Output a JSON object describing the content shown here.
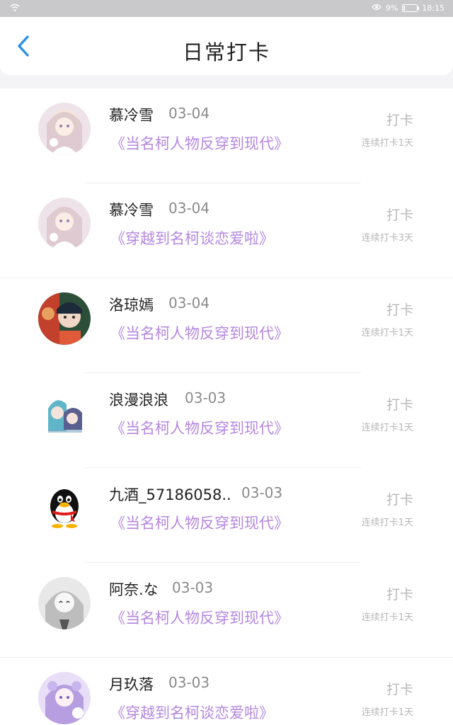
{
  "status": {
    "battery": "9%",
    "time": "18:15",
    "battery_level": 0.09
  },
  "header": {
    "title": "日常打卡"
  },
  "entries": [
    {
      "name": "慕冷雪",
      "date": "03-04",
      "book": "《当名柯人物反穿到现代》",
      "action": "打卡",
      "streak": "连续打卡1天"
    },
    {
      "name": "慕冷雪",
      "date": "03-04",
      "book": "《穿越到名柯谈恋爱啦》",
      "action": "打卡",
      "streak": "连续打卡3天"
    },
    {
      "name": "洛琼嫣",
      "date": "03-04",
      "book": "《当名柯人物反穿到现代》",
      "action": "打卡",
      "streak": "连续打卡1天"
    },
    {
      "name": "浪漫浪浪",
      "date": "03-03",
      "book": "《当名柯人物反穿到现代》",
      "action": "打卡",
      "streak": "连续打卡1天"
    },
    {
      "name": "九酒_57186058..",
      "date": "03-03",
      "book": "《当名柯人物反穿到现代》",
      "action": "打卡",
      "streak": "连续打卡1天"
    },
    {
      "name": "阿奈.な",
      "date": "03-03",
      "book": "《当名柯人物反穿到现代》",
      "action": "打卡",
      "streak": "连续打卡1天"
    },
    {
      "name": "月玖落",
      "date": "03-03",
      "book": "《穿越到名柯谈恋爱啦》",
      "action": "打卡",
      "streak": "连续打卡1天"
    }
  ],
  "colors": {
    "accent_back": "#2b8fe8",
    "book_title": "#b487df",
    "muted": "#b8b8b8"
  },
  "icons": {
    "back": "chevron-left-icon",
    "wifi": "wifi-icon",
    "eye": "eye-icon",
    "battery": "battery-icon"
  }
}
